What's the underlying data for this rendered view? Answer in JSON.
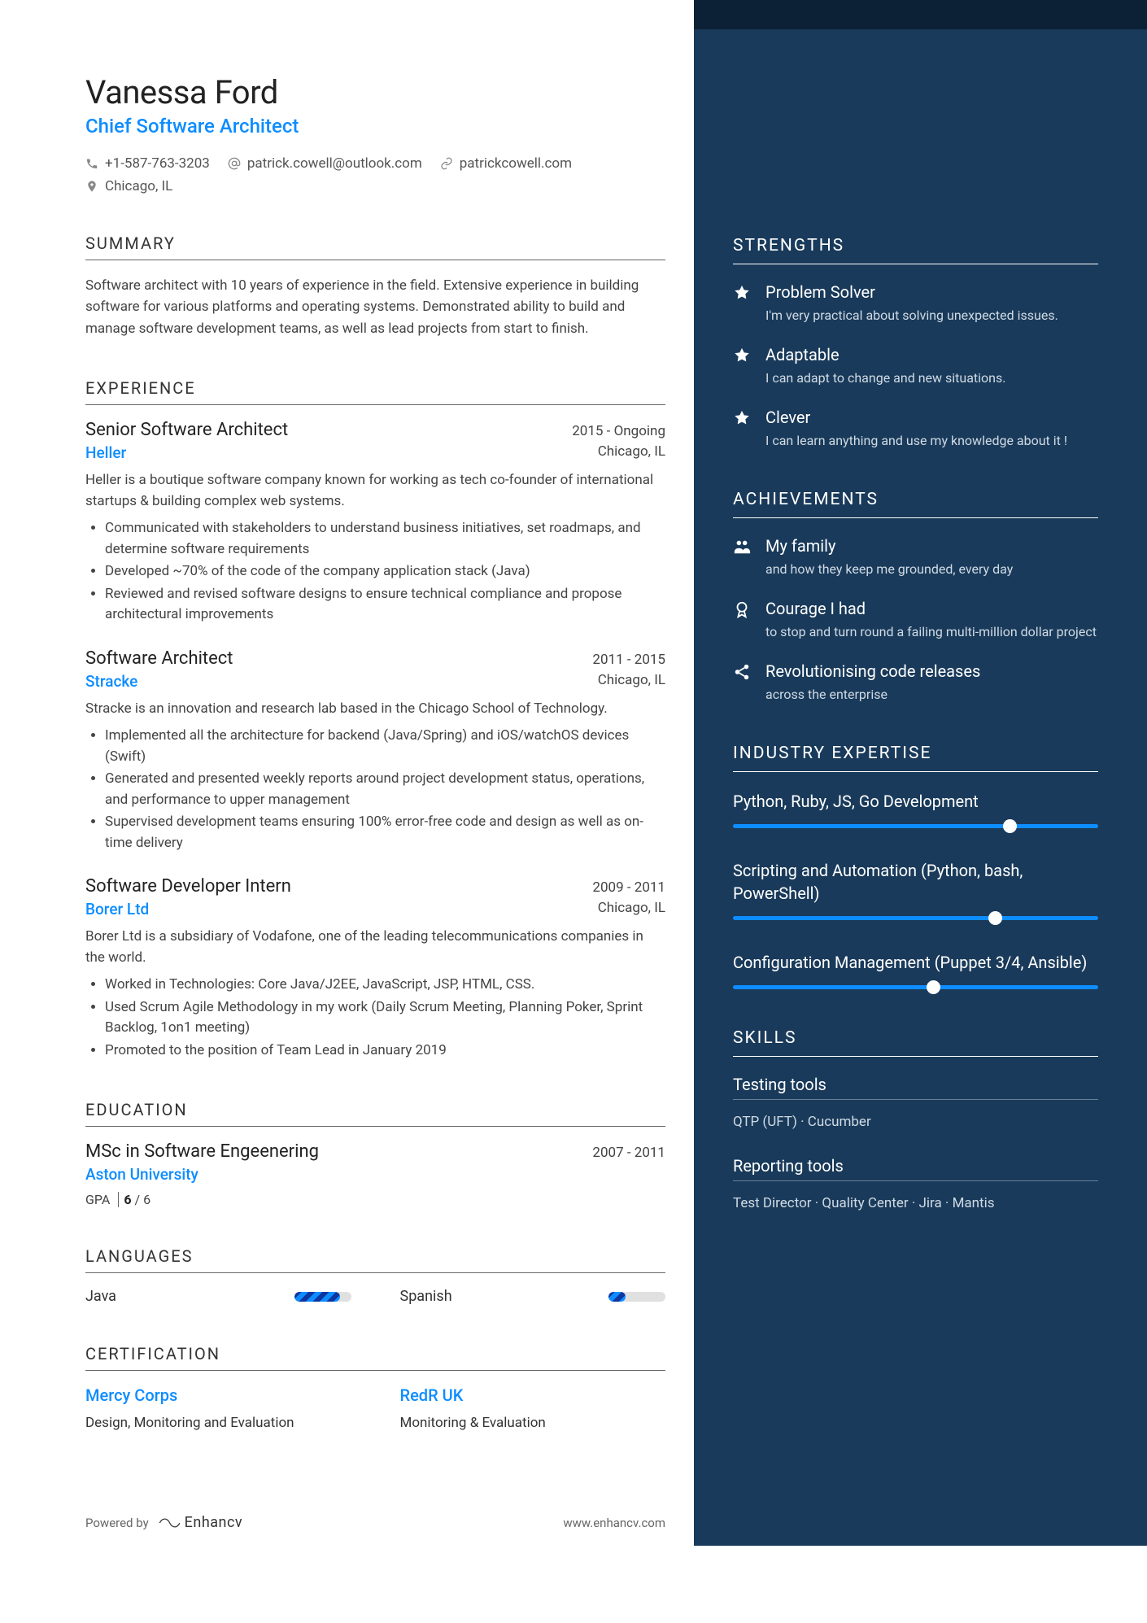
{
  "header": {
    "name": "Vanessa Ford",
    "title": "Chief Software Architect",
    "phone": "+1-587-763-3203",
    "email": "patrick.cowell@outlook.com",
    "website": "patrickcowell.com",
    "location": "Chicago, IL"
  },
  "summary": {
    "heading": "SUMMARY",
    "text": "Software architect with 10 years of experience in the field. Extensive experience in building software for various platforms and operating systems. Demonstrated ability to build and manage software development teams, as well as lead projects from start to finish."
  },
  "experience": {
    "heading": "EXPERIENCE",
    "jobs": [
      {
        "title": "Senior Software Architect",
        "date": "2015 - Ongoing",
        "company": "Heller",
        "location": "Chicago, IL",
        "desc": "Heller is a boutique software company known for working as tech co-founder of international startups & building complex web systems.",
        "bullets": [
          "Communicated with stakeholders to understand business initiatives, set roadmaps, and determine software requirements",
          "Developed ~70% of the code of the company application stack (Java)",
          "Reviewed and revised software designs to ensure technical compliance and propose architectural improvements"
        ]
      },
      {
        "title": "Software Architect",
        "date": "2011 - 2015",
        "company": "Stracke",
        "location": "Chicago, IL",
        "desc": "Stracke is an innovation and research lab based in the Chicago School of Technology.",
        "bullets": [
          "Implemented all the architecture for backend (Java/Spring) and iOS/watchOS devices (Swift)",
          "Generated and presented weekly reports around project development status, operations, and performance to upper management",
          "Supervised development teams ensuring 100% error-free code and design as well as on-time delivery"
        ]
      },
      {
        "title": "Software Developer Intern",
        "date": "2009 - 2011",
        "company": "Borer Ltd",
        "location": "Chicago, IL",
        "desc": "Borer Ltd is a subsidiary of Vodafone, one of the leading telecommunications companies in the world.",
        "bullets": [
          "Worked in Technologies: Core Java/J2EE, JavaScript, JSP, HTML, CSS.",
          "Used Scrum Agile Methodology in my work (Daily Scrum Meeting, Planning Poker, Sprint Backlog, 1on1 meeting)",
          "Promoted to the position of Team Lead in January 2019"
        ]
      }
    ]
  },
  "education": {
    "heading": "EDUCATION",
    "degree": "MSc in Software Engeenering",
    "date": "2007 - 2011",
    "school": "Aston University",
    "gpa_label": "GPA",
    "gpa_value": "6",
    "gpa_max": "6"
  },
  "languages": {
    "heading": "LANGUAGES",
    "items": [
      {
        "name": "Java",
        "level": 80
      },
      {
        "name": "Spanish",
        "level": 30
      }
    ]
  },
  "certifications": {
    "heading": "CERTIFICATION",
    "items": [
      {
        "name": "Mercy Corps",
        "desc": "Design, Monitoring and Evaluation"
      },
      {
        "name": "RedR UK",
        "desc": "Monitoring & Evaluation"
      }
    ]
  },
  "footer": {
    "powered": "Powered by",
    "brand": "Enhancv",
    "url": "www.enhancv.com"
  },
  "strengths": {
    "heading": "STRENGTHS",
    "items": [
      {
        "title": "Problem Solver",
        "desc": "I'm very practical about solving unexpected issues."
      },
      {
        "title": "Adaptable",
        "desc": "I can adapt to change and new situations."
      },
      {
        "title": "Clever",
        "desc": "I can learn anything and use my knowledge about it !"
      }
    ]
  },
  "achievements": {
    "heading": "ACHIEVEMENTS",
    "items": [
      {
        "icon": "family",
        "title": "My family",
        "desc": "and how they keep me grounded, every day"
      },
      {
        "icon": "badge",
        "title": "Courage I had",
        "desc": "to stop and turn round a failing multi-million dollar project"
      },
      {
        "icon": "share",
        "title": "Revolutionising code releases",
        "desc": "across the enterprise"
      }
    ]
  },
  "expertise": {
    "heading": "INDUSTRY EXPERTISE",
    "items": [
      {
        "label": "Python, Ruby, JS, Go Development",
        "level": 74
      },
      {
        "label": "Scripting and Automation (Python, bash, PowerShell)",
        "level": 70
      },
      {
        "label": "Configuration Management (Puppet 3/4, Ansible)",
        "level": 53
      }
    ]
  },
  "skills": {
    "heading": "SKILLS",
    "categories": [
      {
        "title": "Testing tools",
        "items": "QTP (UFT) · Cucumber"
      },
      {
        "title": "Reporting tools",
        "items": "Test Director · Quality Center · Jira · Mantis"
      }
    ]
  }
}
